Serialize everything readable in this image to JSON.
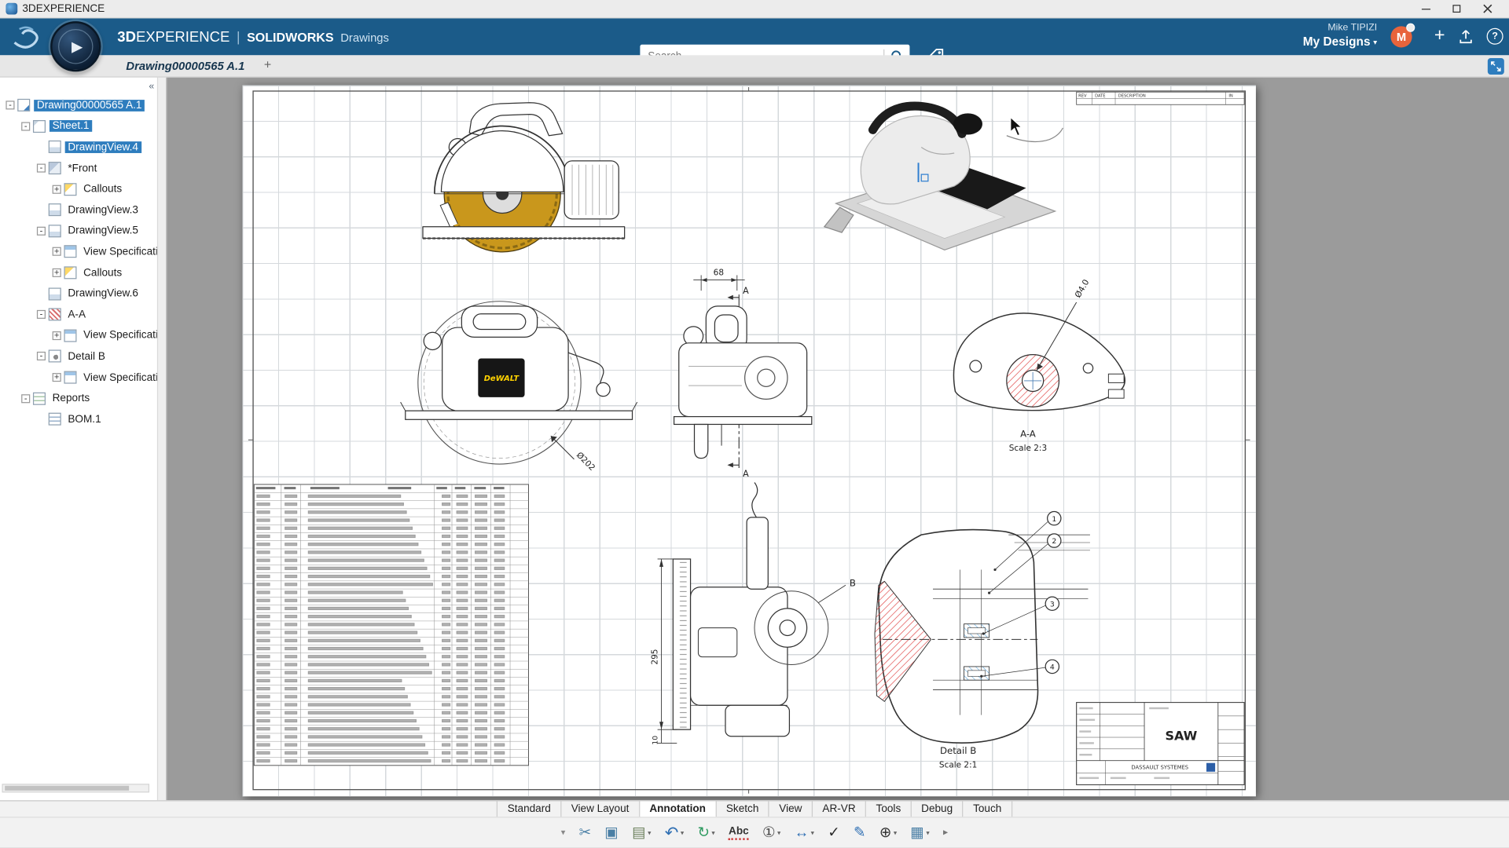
{
  "window": {
    "title": "3DEXPERIENCE"
  },
  "icons": {
    "compass_play": "▶",
    "caret_down": "▾",
    "plus": "+",
    "help": "?"
  },
  "colors": {
    "header_bg": "#1b5b89",
    "selection": "#2e7dbe",
    "accent_blue": "#2e7dbe",
    "avatar": "#e8643c",
    "blade_yellow": "#c9971c",
    "hatch_red": "#e04848",
    "hatch_blue": "#5fa8dc"
  },
  "header": {
    "brand_3d": "3D",
    "brand_experience": "EXPERIENCE",
    "brand_sep": "|",
    "brand_product": "SOLIDWORKS",
    "brand_app": "Drawings",
    "search_placeholder": "Search",
    "user_name": "Mike TIPIZI",
    "workspace": "My Designs",
    "avatar_initial": "M"
  },
  "tabbar": {
    "document_tab": "Drawing00000565 A.1",
    "new_tab": "+"
  },
  "panel": {
    "collapse_glyph": "«"
  },
  "tree": {
    "items": [
      {
        "label": "Drawing00000565 A.1",
        "level": 0,
        "icon": "drawing",
        "expand": "-",
        "selected": true
      },
      {
        "label": "Sheet.1",
        "level": 1,
        "icon": "sheet",
        "expand": "-",
        "selected": true
      },
      {
        "label": "DrawingView.4",
        "level": 2,
        "icon": "view",
        "expand": "",
        "selected": true
      },
      {
        "label": "*Front",
        "level": 2,
        "icon": "front",
        "expand": "-",
        "selected": false
      },
      {
        "label": "Callouts",
        "level": 3,
        "icon": "callouts",
        "expand": "+",
        "selected": false
      },
      {
        "label": "DrawingView.3",
        "level": 2,
        "icon": "view",
        "expand": "",
        "selected": false
      },
      {
        "label": "DrawingView.5",
        "level": 2,
        "icon": "view",
        "expand": "-",
        "selected": false
      },
      {
        "label": "View Specification",
        "level": 3,
        "icon": "spec",
        "expand": "+",
        "selected": false
      },
      {
        "label": "Callouts",
        "level": 3,
        "icon": "callouts",
        "expand": "+",
        "selected": false
      },
      {
        "label": "DrawingView.6",
        "level": 2,
        "icon": "view",
        "expand": "",
        "selected": false
      },
      {
        "label": "A-A",
        "level": 2,
        "icon": "section",
        "expand": "-",
        "selected": false
      },
      {
        "label": "View Specification",
        "level": 3,
        "icon": "spec",
        "expand": "+",
        "selected": false
      },
      {
        "label": "Detail B",
        "level": 2,
        "icon": "detail",
        "expand": "-",
        "selected": false
      },
      {
        "label": "View Specification",
        "level": 3,
        "icon": "spec",
        "expand": "+",
        "selected": false
      },
      {
        "label": "Reports",
        "level": 1,
        "icon": "reports",
        "expand": "-",
        "selected": false
      },
      {
        "label": "BOM.1",
        "level": 2,
        "icon": "bom",
        "expand": "",
        "selected": false
      }
    ]
  },
  "drawing": {
    "dim_width": "68",
    "dim_blade": "Ø202",
    "dim_hole": "Ø4.0",
    "dim_height": "295",
    "dim_base": "10",
    "section_marker": "A",
    "detail_marker": "B",
    "section_title": "A-A",
    "section_scale": "Scale 2:3",
    "detail_title": "Detail B",
    "detail_scale": "Scale 2:1",
    "brand_label": "DeWALT",
    "balloons": [
      "1",
      "2",
      "3",
      "4"
    ],
    "revision_table": {
      "headers": [
        "REV",
        "DATE",
        "DESCRIPTION",
        "IN"
      ]
    },
    "title_block": {
      "part_title": "SAW",
      "company": "DASSAULT SYSTEMES"
    }
  },
  "ribbon": {
    "tabs": [
      "Standard",
      "View Layout",
      "Annotation",
      "Sketch",
      "View",
      "AR-VR",
      "Tools",
      "Debug",
      "Touch"
    ],
    "active": "Annotation"
  },
  "toolbar": {
    "buttons": [
      {
        "name": "overflow",
        "glyph": "▾",
        "dropdown": false
      },
      {
        "name": "cut",
        "glyph": "✂",
        "dropdown": false
      },
      {
        "name": "copy",
        "glyph": "▣",
        "dropdown": false
      },
      {
        "name": "paste",
        "glyph": "▤",
        "dropdown": true
      },
      {
        "name": "undo",
        "glyph": "↶",
        "dropdown": true
      },
      {
        "name": "rebuild",
        "glyph": "↻",
        "dropdown": true
      },
      {
        "name": "spellcheck",
        "glyph": "Abc",
        "dropdown": false
      },
      {
        "name": "balloon",
        "glyph": "①",
        "dropdown": true
      },
      {
        "name": "dimension",
        "glyph": "↔",
        "dropdown": true
      },
      {
        "name": "approve",
        "glyph": "✓",
        "dropdown": false
      },
      {
        "name": "annotate-pen",
        "glyph": "✎",
        "dropdown": false
      },
      {
        "name": "origin",
        "glyph": "⊕",
        "dropdown": true
      },
      {
        "name": "table",
        "glyph": "▦",
        "dropdown": true
      },
      {
        "name": "more",
        "glyph": "▸",
        "dropdown": false
      }
    ]
  }
}
